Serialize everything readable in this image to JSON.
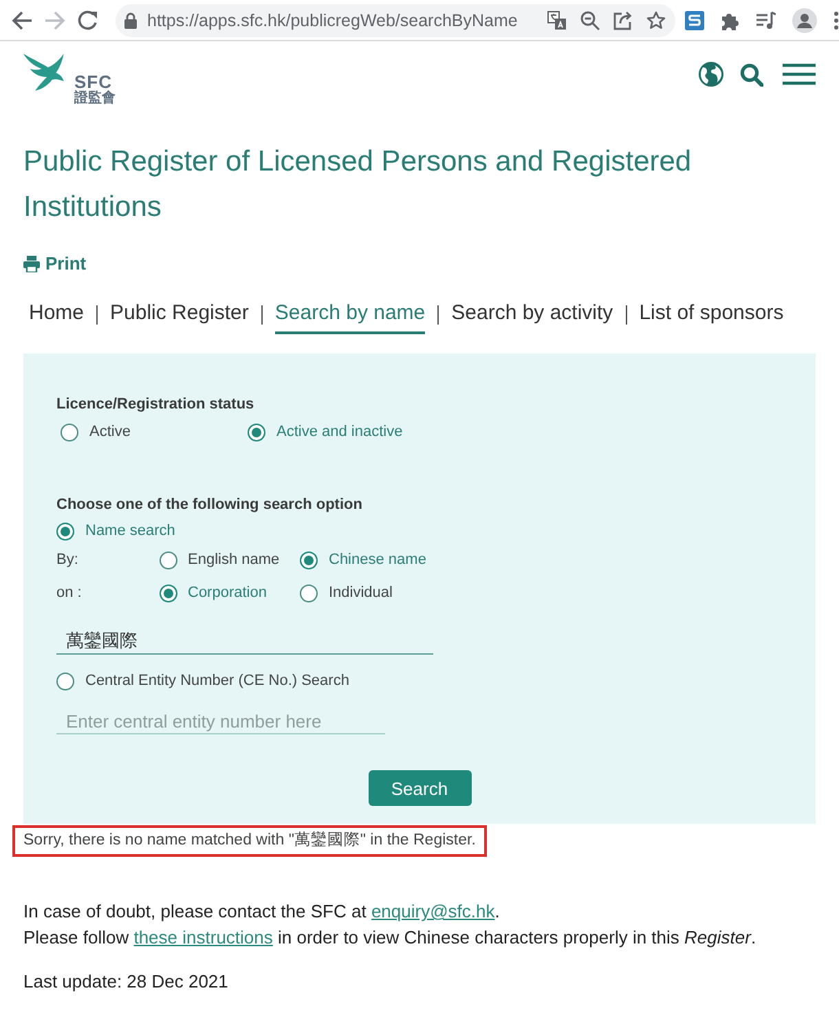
{
  "browser": {
    "url": "https://apps.sfc.hk/publicregWeb/searchByName"
  },
  "header": {
    "logo": {
      "abbr": "SFC",
      "chinese": "證監會"
    }
  },
  "title": "Public Register of Licensed Persons and Registered Institutions",
  "print": "Print",
  "nav": [
    {
      "label": "Home",
      "selected": false
    },
    {
      "label": "Public Register",
      "selected": false
    },
    {
      "label": "Search by name",
      "selected": true
    },
    {
      "label": "Search by activity",
      "selected": false
    },
    {
      "label": "List of sponsors",
      "selected": false
    }
  ],
  "form": {
    "status": {
      "label": "Licence/Registration status",
      "options": [
        {
          "label": "Active",
          "selected": false
        },
        {
          "label": "Active and inactive",
          "selected": true
        }
      ]
    },
    "search_option_label": "Choose one of the following search option",
    "name_search": {
      "label": "Name search",
      "selected": true,
      "by": {
        "label": "By:",
        "options": [
          {
            "label": "English name",
            "selected": false
          },
          {
            "label": "Chinese name",
            "selected": true
          }
        ]
      },
      "on": {
        "label": "on :",
        "options": [
          {
            "label": "Corporation",
            "selected": true
          },
          {
            "label": "Individual",
            "selected": false
          }
        ]
      },
      "value": "萬鑾國際"
    },
    "ce_search": {
      "label": "Central Entity Number (CE No.) Search",
      "selected": false,
      "placeholder": "Enter central entity number here"
    },
    "button": "Search"
  },
  "message": {
    "text": "Sorry, there is no name matched with \"萬鑾國際\" in the Register.",
    "highlighted": true
  },
  "footer": {
    "contact": {
      "before": "In case of doubt, please contact the SFC at ",
      "link": "enquiry@sfc.hk",
      "after": "."
    },
    "instructions": {
      "before": "Please follow ",
      "link": "these instructions",
      "after": " in order to view Chinese characters properly in this *Register*."
    },
    "last_update": "Last update: 28 Dec 2021"
  }
}
